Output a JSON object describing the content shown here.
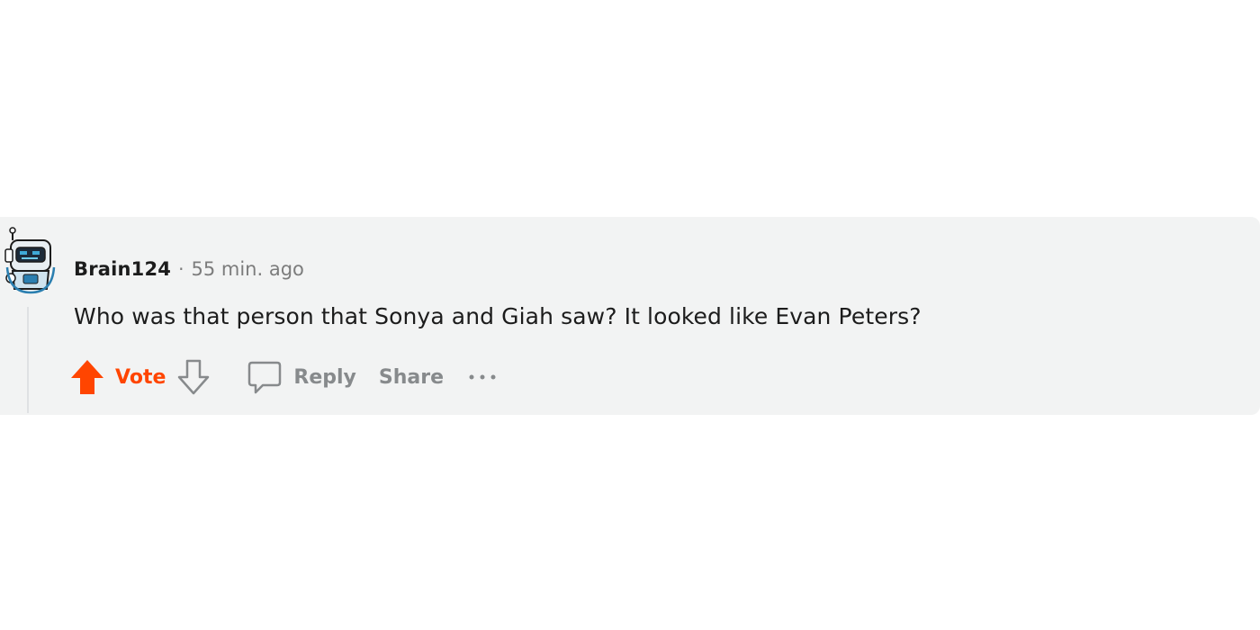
{
  "comment": {
    "author": "Brain124",
    "separator": "·",
    "timestamp": "55 min. ago",
    "text": "Who was that person that Sonya and Giah saw? It looked like Evan Peters?",
    "avatar_icon": "robot-avatar-icon"
  },
  "actions": {
    "upvote_icon": "upvote-arrow-icon",
    "vote_label": "Vote",
    "downvote_icon": "downvote-arrow-icon",
    "reply_icon": "speech-bubble-icon",
    "reply_label": "Reply",
    "share_label": "Share",
    "more_icon": "ellipsis-icon"
  },
  "colors": {
    "comment_background": "#f2f3f3",
    "accent_upvote": "#ff4500",
    "muted_text": "#878a8c",
    "primary_text": "#1c1c1c"
  }
}
